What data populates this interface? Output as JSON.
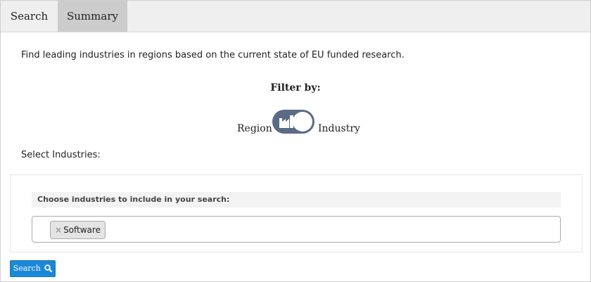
{
  "tabs": [
    {
      "label": "Search",
      "active": false
    },
    {
      "label": "Summary",
      "active": true
    }
  ],
  "intro_text": "Find leading industries in regions based on the current state of EU funded research.",
  "filter": {
    "title": "Filter by:",
    "left_label": "Region",
    "right_label": "Industry",
    "selected": "Industry",
    "toggle_icon": "factory-icon"
  },
  "select_label": "Select Industries:",
  "industries_panel": {
    "heading": "Choose industries to include in your search:",
    "remove_glyph": "×",
    "selected_tags": [
      "Software"
    ]
  },
  "search_button": {
    "label": "Search",
    "icon": "search-icon"
  },
  "colors": {
    "tab_active_bg": "#cccccc",
    "toggle_bg": "#5b6b86",
    "button_bg": "#1a88d8"
  }
}
